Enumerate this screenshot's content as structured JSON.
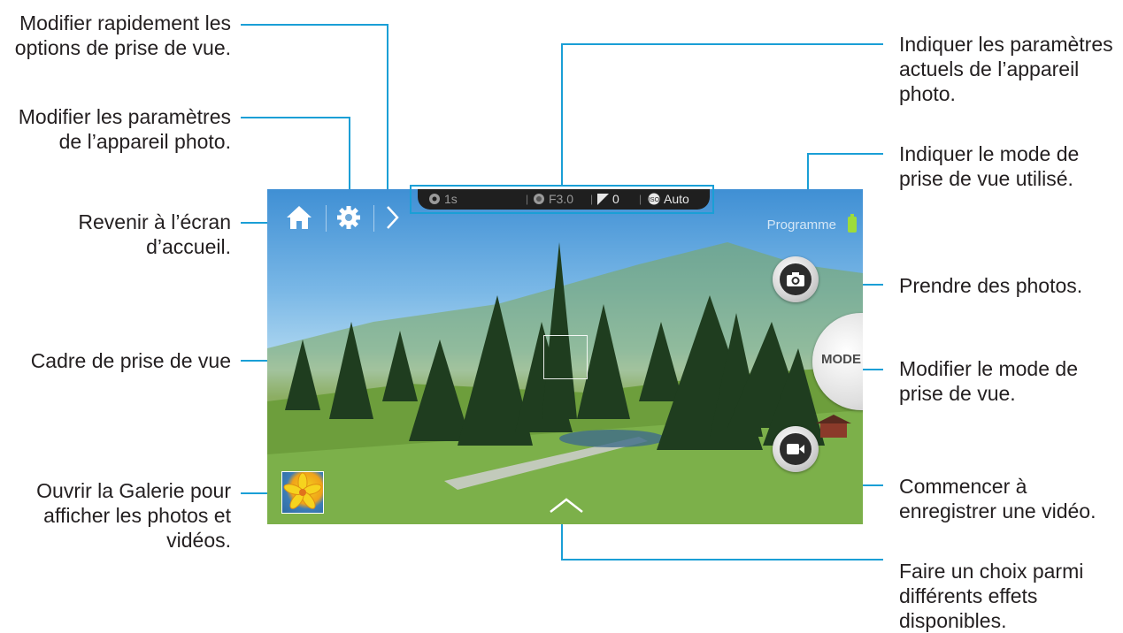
{
  "annotations_left": {
    "quick_settings": "Modifier rapidement les options de prise de vue.",
    "settings": "Modifier les paramètres de l’appareil photo.",
    "home": "Revenir à l’écran d’accueil.",
    "frame": "Cadre de prise de vue",
    "gallery": "Ouvrir la Galerie pour afficher les photos et vidéos."
  },
  "annotations_right": {
    "current_settings": "Indiquer les paramètres actuels de l’appareil photo.",
    "mode_in_use": "Indiquer le mode de prise de vue utilisé.",
    "take_photo": "Prendre des photos.",
    "change_mode": "Modifier le mode de prise de vue.",
    "record_video": "Commencer à enregistrer une vidéo.",
    "effects": "Faire un choix parmi différents effets disponibles."
  },
  "camera": {
    "status": {
      "shutter": "1s",
      "aperture": "F3.0",
      "exposure": "0",
      "iso": "Auto"
    },
    "mode_label": "Programme",
    "mode_button": "MODE"
  },
  "icons": {
    "home": "home-icon",
    "settings": "gear-icon",
    "quick": "chevron-right-icon",
    "photo": "camera-icon",
    "video": "video-camera-icon",
    "effects": "chevron-up-icon",
    "battery": "battery-icon"
  },
  "colors": {
    "callout_line": "#1a9fd6",
    "battery": "#9edc3a"
  }
}
